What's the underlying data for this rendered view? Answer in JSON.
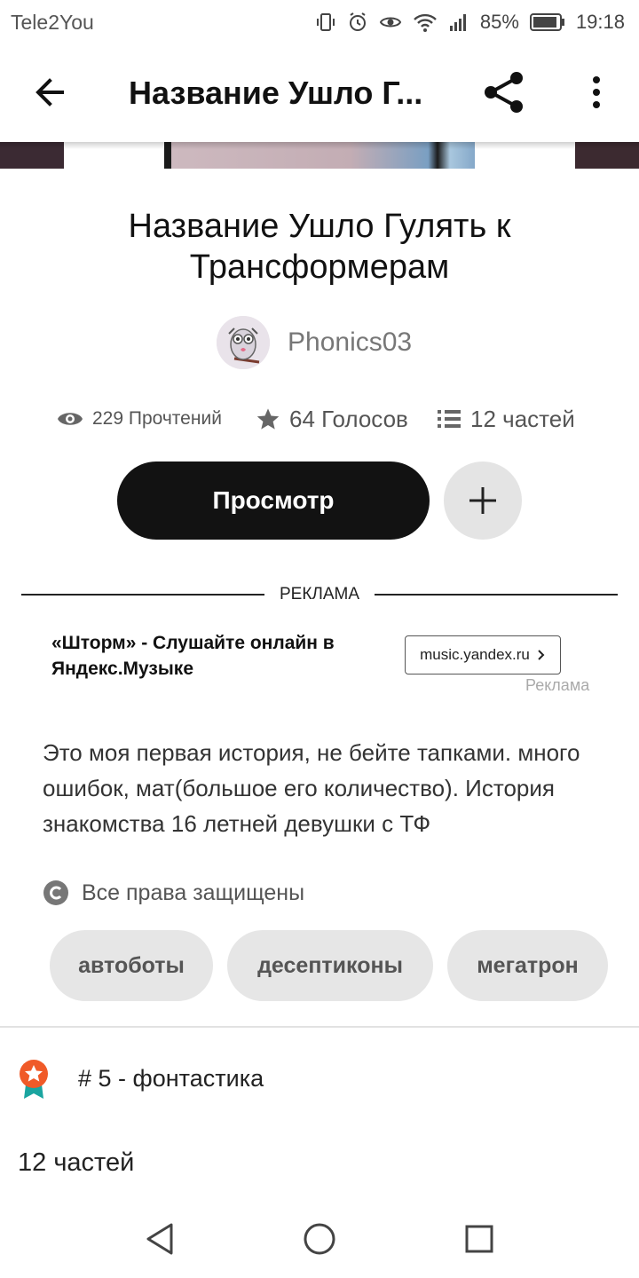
{
  "status_bar": {
    "carrier": "Tele2You",
    "battery": "85%",
    "time": "19:18"
  },
  "app_bar": {
    "title": "Название Ушло Г..."
  },
  "story": {
    "title": "Название Ушло Гулять к Трансформерам",
    "author": "Phonics03",
    "stats": {
      "reads": "229 Прочтений",
      "votes": "64 Голосов",
      "parts": "12 частей"
    },
    "read_button": "Просмотр",
    "description": "Это моя первая история, не бейте тапками. много ошибок, мат(большое его количество). История знакомства 16 летней девушки с ТФ",
    "copyright": "Все права защищены",
    "tags": [
      "автоботы",
      "десептиконы",
      "мегатрон"
    ],
    "rank": "# 5 - фонтастика",
    "parts_count": "12 частей"
  },
  "ad": {
    "divider_label": "РЕКЛАМА",
    "text": "«Шторм» - Слушайте онлайн в Яндекс.Музыке",
    "link": "music.yandex.ru",
    "sub_label": "Реклама"
  },
  "colors": {
    "primary_button": "#121212",
    "tag_bg": "#e6e6e6",
    "rank_badge": "#f05a28"
  }
}
